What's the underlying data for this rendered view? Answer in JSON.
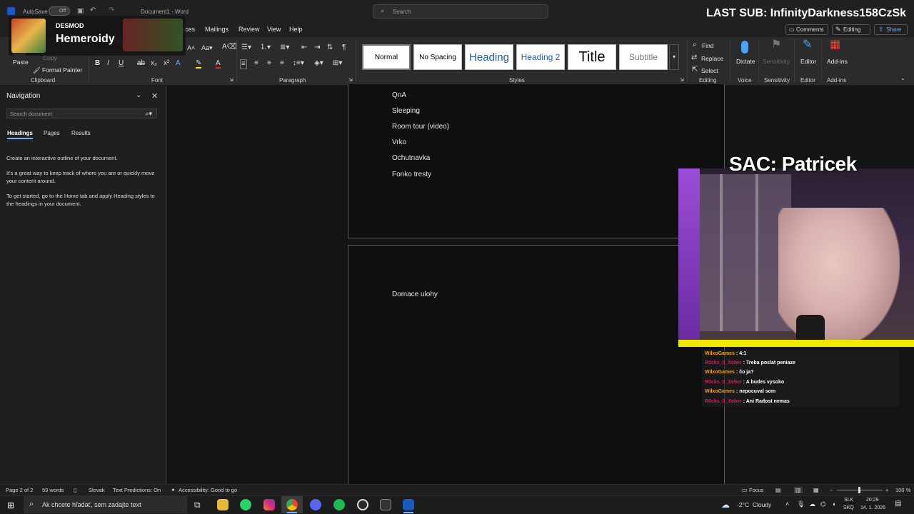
{
  "titlebar": {
    "autosave_label": "AutoSave",
    "autosave_state": "Off",
    "document_title": "Document1 - Word",
    "search_placeholder": "Search"
  },
  "overlay": {
    "badge_small": "DESMOD",
    "badge_big": "Hemeroidy",
    "last_sub": "LAST SUB: InfinityDarkness158CzSk",
    "sac_title": "SAC: Patricek"
  },
  "menu": {
    "tabs": [
      "nces",
      "Mailings",
      "Review",
      "View",
      "Help"
    ],
    "comments": "Comments",
    "editing": "Editing",
    "share": "Share"
  },
  "ribbon": {
    "paste": "Paste",
    "copy": "Copy",
    "format_painter": "Format Painter",
    "groups": [
      "Clipboard",
      "Font",
      "Paragraph",
      "Styles",
      "Editing",
      "Voice",
      "Sensitivity",
      "Editor",
      "Add-ins"
    ],
    "styles": [
      "Normal",
      "No Spacing",
      "Heading",
      "Heading 2",
      "Title",
      "Subtitle"
    ],
    "find": "Find",
    "replace": "Replace",
    "select": "Select",
    "dictate": "Dictate",
    "sensitivity": "Sensitivity",
    "editor": "Editor",
    "addins": "Add-ins"
  },
  "navigation": {
    "title": "Navigation",
    "search_placeholder": "Search document",
    "tabs": [
      "Headings",
      "Pages",
      "Results"
    ],
    "para1": "Create an interactive outline of your document.",
    "para2": "It's a great way to keep track of where you are or quickly move your content around.",
    "para3": "To get started, go to the Home tab and apply Heading styles to the headings in your document."
  },
  "document": {
    "page1_lines": [
      "QnA",
      "Sleeping",
      "Room tour (video)",
      "Vrko",
      "Ochutnavka",
      "Fonko tresty"
    ],
    "page2_lines": [
      "Domace ulohy"
    ]
  },
  "chat": [
    {
      "user": "WilxoGames",
      "msg": "4:1",
      "color": "#e8a21a"
    },
    {
      "user": "R0cks_0_Xeber",
      "msg": "Treba poslat peniaze",
      "color": "#c0245a"
    },
    {
      "user": "WilxoGames",
      "msg": "čo ja?",
      "color": "#e8a21a"
    },
    {
      "user": "R0cks_0_Xeber",
      "msg": "A budes vysoko",
      "color": "#c0245a"
    },
    {
      "user": "WilxoGames",
      "msg": "nepocuval som",
      "color": "#e8a21a"
    },
    {
      "user": "R0cks_0_Xeber",
      "msg": "Ani Radost nemas",
      "color": "#c0245a"
    }
  ],
  "statusbar": {
    "page": "Page 2 of 2",
    "words": "59 words",
    "language": "Slovak",
    "predictions": "Text Predictions: On",
    "accessibility": "Accessibility: Good to go",
    "focus": "Focus",
    "zoom": "100 %"
  },
  "taskbar": {
    "search_placeholder": "Ak chcete hľadať, sem zadajte text",
    "weather": "-2°C  Cloudy",
    "lang_top": "SLK",
    "lang_bottom": "SKQ",
    "time": "20:29",
    "date": "14. 1. 2026"
  }
}
